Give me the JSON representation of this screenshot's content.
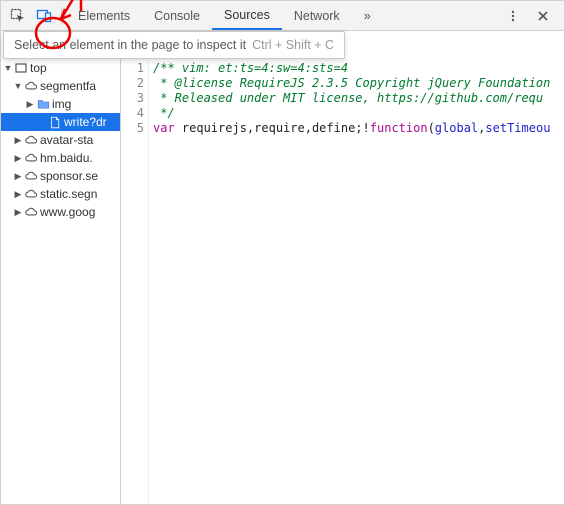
{
  "toolbar": {
    "tabs": [
      "Elements",
      "Console",
      "Sources",
      "Network"
    ],
    "active_tab": 2,
    "overflow_glyph": "»"
  },
  "tooltip": {
    "text": "Select an element in the page to inspect it",
    "shortcut": "Ctrl + Shift + C"
  },
  "tree": {
    "top": "top",
    "items": [
      {
        "label": "segmentfa",
        "icon": "cloud",
        "expanded": true,
        "indent": 1
      },
      {
        "label": "img",
        "icon": "folder",
        "expanded": false,
        "indent": 2
      },
      {
        "label": "write?dr",
        "icon": "file",
        "indent": 3,
        "selected": true
      },
      {
        "label": "avatar-sta",
        "icon": "cloud",
        "expanded": false,
        "indent": 1
      },
      {
        "label": "hm.baidu.",
        "icon": "cloud",
        "expanded": false,
        "indent": 1
      },
      {
        "label": "sponsor.se",
        "icon": "cloud",
        "expanded": false,
        "indent": 1
      },
      {
        "label": "static.segn",
        "icon": "cloud",
        "expanded": false,
        "indent": 1
      },
      {
        "label": "www.goog",
        "icon": "cloud",
        "expanded": false,
        "indent": 1
      }
    ]
  },
  "code": {
    "lines": [
      {
        "n": 1,
        "cls": "c-comment",
        "t": "/** vim: et:ts=4:sw=4:sts=4"
      },
      {
        "n": 2,
        "cls": "c-comment",
        "t": " * @license RequireJS 2.3.5 Copyright jQuery Foundation"
      },
      {
        "n": 3,
        "cls": "c-comment",
        "t": " * Released under MIT license, https://github.com/requ"
      },
      {
        "n": 4,
        "cls": "c-comment",
        "t": " */"
      },
      {
        "n": 5,
        "cls": "mixed",
        "t": ""
      }
    ],
    "line5": {
      "var": "var",
      "ids": " requirejs,require,define;",
      "bang": "!",
      "fn": "function",
      "args_open": "(",
      "arg1": "global",
      "comma": ",",
      "arg2": "setTimeou"
    }
  }
}
